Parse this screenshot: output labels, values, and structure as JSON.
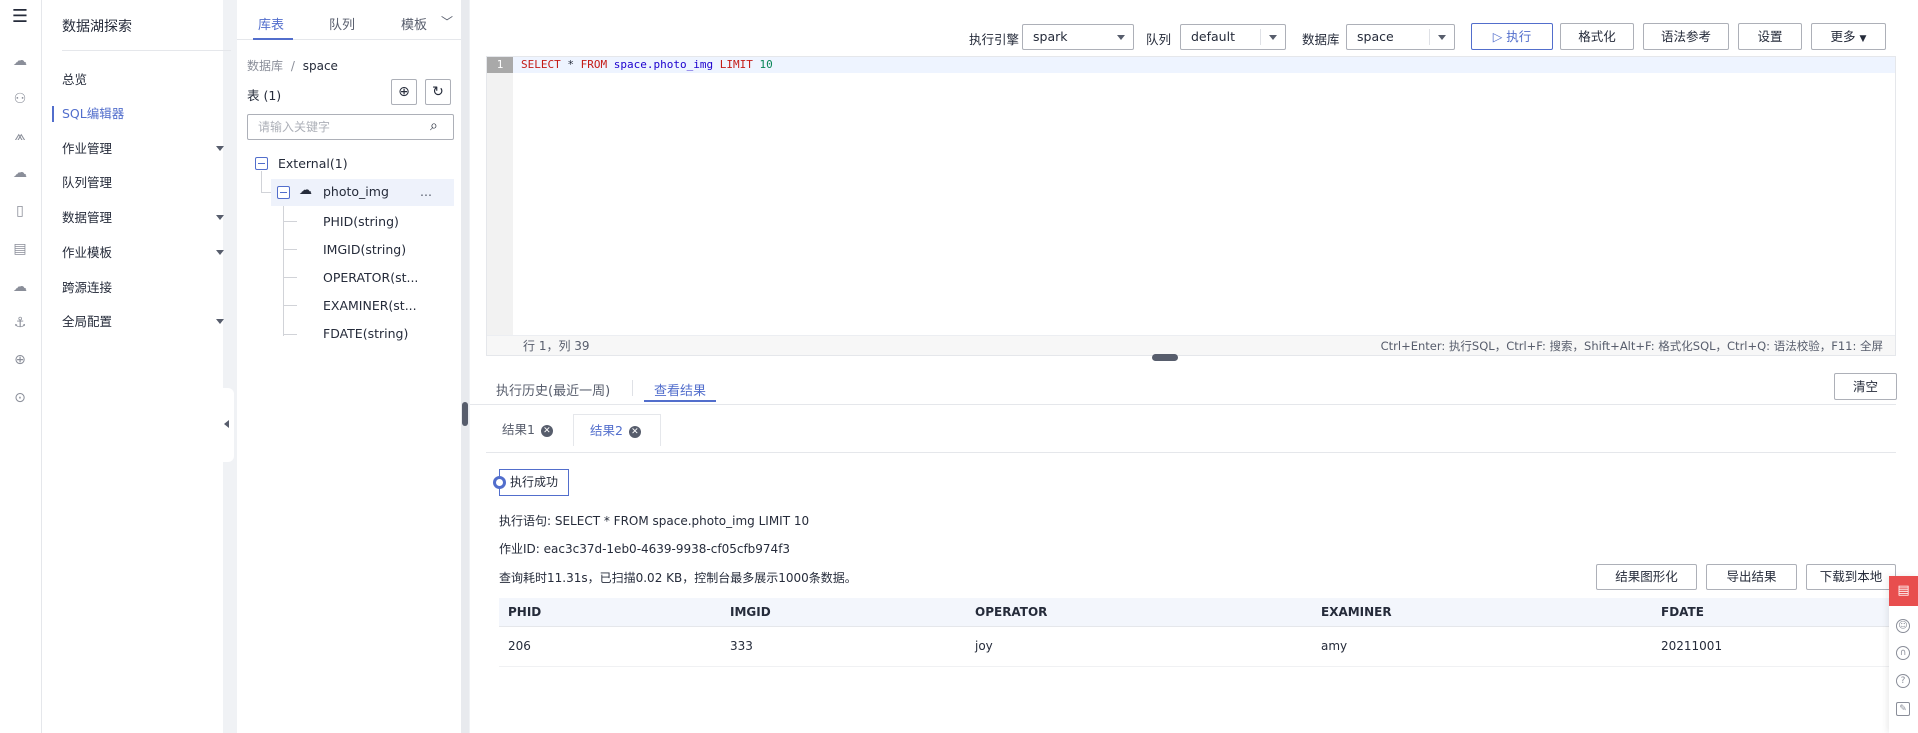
{
  "nav": {
    "title": "数据湖探索",
    "items": [
      {
        "label": "总览",
        "expandable": false,
        "active": false
      },
      {
        "label": "SQL编辑器",
        "expandable": false,
        "active": true
      },
      {
        "label": "作业管理",
        "expandable": true,
        "active": false
      },
      {
        "label": "队列管理",
        "expandable": false,
        "active": false
      },
      {
        "label": "数据管理",
        "expandable": true,
        "active": false
      },
      {
        "label": "作业模板",
        "expandable": true,
        "active": false
      },
      {
        "label": "跨源连接",
        "expandable": false,
        "active": false
      },
      {
        "label": "全局配置",
        "expandable": true,
        "active": false
      }
    ]
  },
  "tree": {
    "tabs": [
      "库表",
      "队列",
      "模板"
    ],
    "breadcrumb_root": "数据库",
    "breadcrumb_sep": "/",
    "breadcrumb_db": "space",
    "table_count_label": "表 (1)",
    "search_placeholder": "请输入关键字",
    "group_label": "External(1)",
    "table_name": "photo_img",
    "table_more": "...",
    "columns": [
      "PHID(string)",
      "IMGID(string)",
      "OPERATOR(st...",
      "EXAMINER(st...",
      "FDATE(string)"
    ]
  },
  "toolbar": {
    "engine_label": "执行引擎",
    "engine_value": "spark",
    "queue_label": "队列",
    "queue_value": "default",
    "db_label": "数据库",
    "db_value": "space",
    "execute_label": "执行",
    "format_label": "格式化",
    "syntax_label": "语法参考",
    "settings_label": "设置",
    "more_label": "更多"
  },
  "editor": {
    "line_number": "1",
    "sql": {
      "select": "SELECT",
      "star": "*",
      "from": "FROM",
      "table": "space.photo_img",
      "limit": "LIMIT",
      "n": "10"
    },
    "cursor_pos": "行 1，列 39",
    "shortcuts": "Ctrl+Enter: 执行SQL，Ctrl+F: 搜索，Shift+Alt+F: 格式化SQL，Ctrl+Q: 语法校验，F11: 全屏"
  },
  "results": {
    "tabs": [
      "执行历史(最近一周)",
      "查看结果"
    ],
    "clear_label": "清空",
    "result_tabs": [
      "结果1",
      "结果2"
    ],
    "status": "执行成功",
    "statement": "执行语句: SELECT * FROM space.photo_img LIMIT 10",
    "job_id": "作业ID: eac3c37d-1eb0-4639-9938-cf05cfb974f3",
    "stats": "查询耗时11.31s，已扫描0.02 KB，控制台最多展示1000条数据。",
    "btn_chart": "结果图形化",
    "btn_export": "导出结果",
    "btn_download": "下载到本地",
    "columns": [
      "PHID",
      "IMGID",
      "OPERATOR",
      "EXAMINER",
      "FDATE"
    ],
    "rows": [
      [
        "206",
        "333",
        "joy",
        "amy",
        "20211001"
      ]
    ]
  },
  "colors": {
    "accent": "#526ecc",
    "float_red": "#e84e4e"
  }
}
